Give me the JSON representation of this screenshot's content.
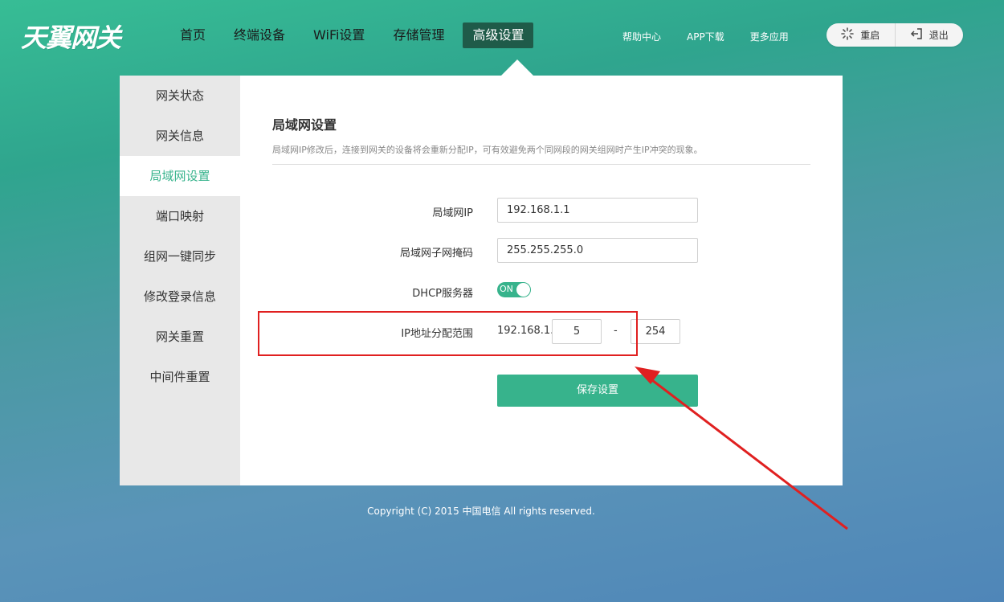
{
  "header": {
    "logo": "天翼网关",
    "nav": [
      "首页",
      "终端设备",
      "WiFi设置",
      "存储管理",
      "高级设置"
    ],
    "links": [
      "帮助中心",
      "APP下载",
      "更多应用"
    ],
    "reboot": "重启",
    "logout": "退出"
  },
  "sidebar": {
    "items": [
      "网关状态",
      "网关信息",
      "局域网设置",
      "端口映射",
      "组网一键同步",
      "修改登录信息",
      "网关重置",
      "中间件重置"
    ]
  },
  "content": {
    "title": "局域网设置",
    "description": "局域网IP修改后，连接到网关的设备将会重新分配IP，可有效避免两个同网段的网关组网时产生IP冲突的现象。",
    "lan_ip_label": "局域网IP",
    "lan_ip_value": "192.168.1.1",
    "subnet_label": "局域网子网掩码",
    "subnet_value": "255.255.255.0",
    "dhcp_label": "DHCP服务器",
    "dhcp_toggle": "ON",
    "range_label": "IP地址分配范围",
    "range_prefix": "192.168.1.",
    "range_start": "5",
    "range_sep": "-",
    "range_end": "254",
    "save_label": "保存设置"
  },
  "footer": {
    "copyright": "Copyright (C) 2015 中国电信 All rights reserved."
  },
  "colors": {
    "accent": "#37b38c",
    "active_nav": "#1f5b49",
    "annotation": "#e02020"
  }
}
